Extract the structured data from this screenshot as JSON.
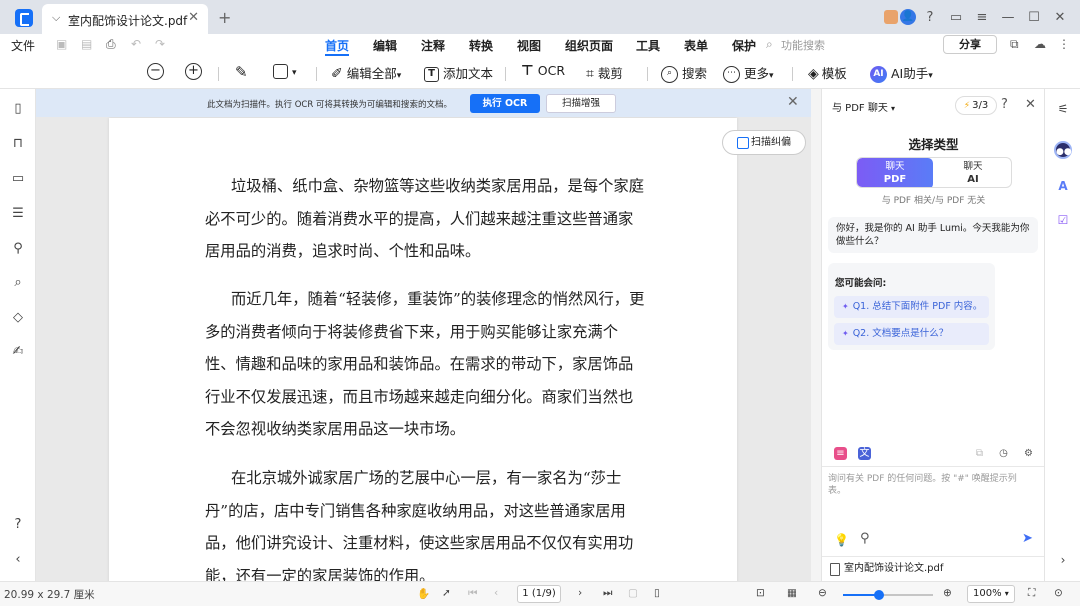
{
  "titlebar": {
    "tab_title": "室内配饰设计论文.pdf",
    "icons": [
      "notification-icon",
      "avatar-icon",
      "help-icon",
      "message-icon",
      "menu-icon",
      "minimize-icon",
      "maximize-icon",
      "close-icon"
    ]
  },
  "menubar": {
    "file": "文件",
    "tabs": [
      "首页",
      "编辑",
      "注释",
      "转换",
      "视图",
      "组织页面",
      "工具",
      "表单",
      "保护"
    ],
    "active_tab": "首页",
    "search_placeholder": "功能搜索",
    "share": "分享"
  },
  "toolbar": {
    "edit_all": "编辑全部",
    "add_text": "添加文本",
    "ocr": "OCR",
    "crop": "裁剪",
    "search": "搜索",
    "more": "更多",
    "template": "模板",
    "ai_assistant": "AI助手",
    "ai_badge": "AI"
  },
  "ocr_banner": {
    "message": "此文档为扫描件。执行 OCR 可将其转换为可编辑和搜索的文档。",
    "run_ocr": "执行 OCR",
    "scan_enhance": "扫描增强"
  },
  "document": {
    "deskew": "扫描纠偏",
    "paragraphs": [
      "垃圾桶、纸巾盒、杂物篮等这些收纳类家居用品，是每个家庭必不可少的。随着消费水平的提高，人们越来越注重这些普通家居用品的消费，追求时尚、个性和品味。",
      "而近几年，随着“轻装修，重装饰”的装修理念的悄然风行，更多的消费者倾向于将装修费省下来，用于购买能够让家充满个性、情趣和品味的家用品和装饰品。在需求的带动下，家居饰品行业不仅发展迅速，而且市场越来越走向细分化。商家们当然也不会忽视收纳类家居用品这一块市场。",
      "在北京城外诚家居广场的艺展中心一层，有一家名为“莎士丹”的店，店中专门销售各种家庭收纳用品，对这些普通家居用品，他们讲究设计、注重材料，使这些家居用品不仅仅有实用功能，还有一定的家居装饰的作用。"
    ]
  },
  "ai_panel": {
    "mode_select": "与 PDF 聊天",
    "quota": "3/3",
    "choose_type": "选择类型",
    "seg_pdf_top": "聊天",
    "seg_pdf_bottom": "PDF",
    "seg_ai_top": "聊天",
    "seg_ai_bottom": "AI",
    "seg_sub": "与 PDF 相关/与 PDF 无关",
    "greeting": "你好，我是你的 AI 助手 Lumi。今天我能为你做些什么？",
    "questions_title": "您可能会问:",
    "questions": [
      "Q1. 总结下面附件 PDF 内容。",
      "Q2. 文档要点是什么？"
    ],
    "input_placeholder": "询问有关 PDF 的任何问题。按 \"#\" 唤醒提示列表。",
    "file_name": "室内配饰设计论文.pdf"
  },
  "statusbar": {
    "page_size": "20.99 x 29.7 厘米",
    "page_indicator": "1 (1/9)",
    "zoom_value": "100%",
    "zoom_fraction": 0.4
  },
  "colors": {
    "accent": "#1670f7",
    "banner": "#dde8f7",
    "ai_gradient_start": "#7c5cf5"
  }
}
